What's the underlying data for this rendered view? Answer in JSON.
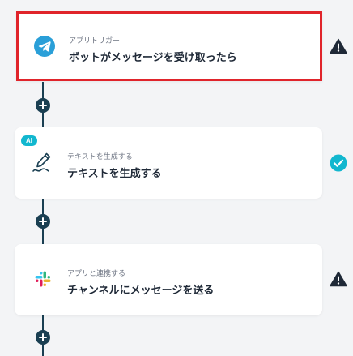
{
  "flow": {
    "steps": [
      {
        "subtitle": "アプリトリガー",
        "title": "ボットがメッセージを受け取ったら",
        "icon": "telegram-icon",
        "status": "warning-icon",
        "selected": true
      },
      {
        "badge": "AI",
        "subtitle": "テキストを生成する",
        "title": "テキストを生成する",
        "icon": "pen-icon",
        "status": "check-icon",
        "selected": false
      },
      {
        "subtitle": "アプリと連携する",
        "title": "チャンネルにメッセージを送る",
        "icon": "slack-icon",
        "status": "warning-icon",
        "selected": false
      }
    ],
    "add_step_icon": "plus-icon"
  },
  "colors": {
    "selected_border": "#e0242b",
    "connector": "#1a3f52",
    "ai_badge": "#12b7cf",
    "check": "#12b7cf",
    "warning": "#1f2937",
    "telegram": "#2a9fd8"
  }
}
